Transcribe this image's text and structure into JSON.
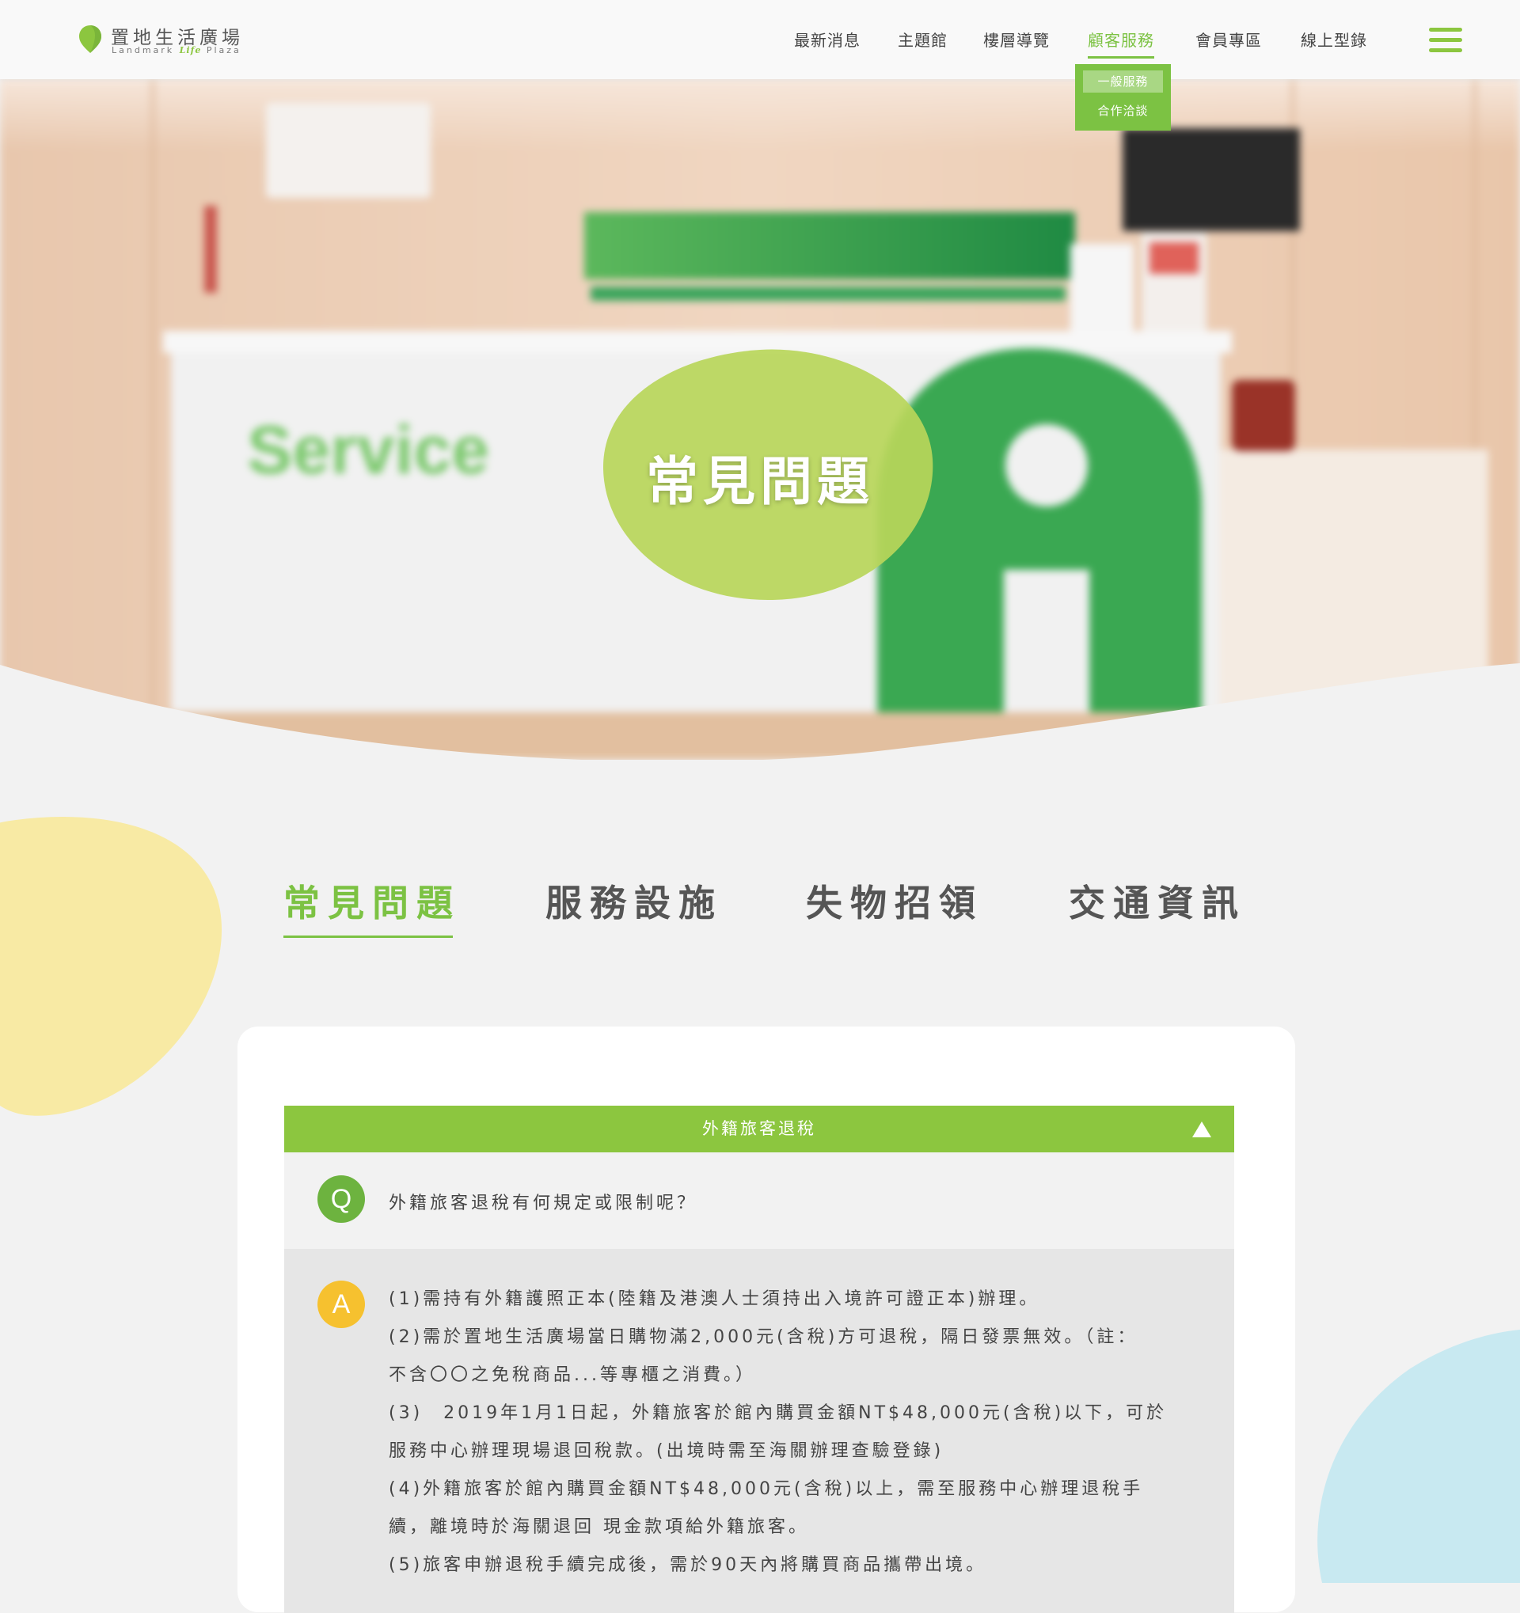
{
  "header": {
    "logo": {
      "cn": "置地生活廣場",
      "en_a": "Landmark",
      "en_b": "Life",
      "en_c": "Plaza"
    },
    "nav": [
      "最新消息",
      "主題館",
      "樓層導覽",
      "顧客服務",
      "會員專區",
      "線上型錄"
    ],
    "active_nav": "顧客服務",
    "dropdown": [
      "一般服務",
      "合作洽談"
    ]
  },
  "hero": {
    "title": "常見問題",
    "background_sign": "Service"
  },
  "tabs": [
    "常見問題",
    "服務設施",
    "失物招領",
    "交通資訊"
  ],
  "faq": {
    "category": "外籍旅客退稅",
    "q_badge": "Q",
    "a_badge": "A",
    "question": "外籍旅客退稅有何規定或限制呢？",
    "answer_lines": [
      "(1)需持有外籍護照正本(陸籍及港澳人士須持出入境許可證正本)辦理。",
      "(2)需於置地生活廣場當日購物滿2,000元(含稅)方可退稅，隔日發票無效。（註：",
      "不含〇〇之免稅商品...等專櫃之消費。）",
      "(3)　2019年1月1日起，外籍旅客於館內購買金額NT$48,000元(含稅)以下，可於",
      "服務中心辦理現場退回稅款。(出境時需至海關辦理查驗登錄)",
      "(4)外籍旅客於館內購買金額NT$48,000元(含稅)以上，需至服務中心辦理退稅手",
      "續，離境時於海關退回 現金款項給外籍旅客。",
      "(5)旅客申辦退稅手續完成後，需於90天內將購買商品攜帶出境。"
    ]
  },
  "colors": {
    "accent_green": "#7cc243",
    "bar_green": "#8cc63f",
    "q_badge": "#6db33f",
    "a_badge": "#f6c12f",
    "blob_yellow": "#f8eaa4",
    "blob_blue": "#c8e9f1"
  }
}
